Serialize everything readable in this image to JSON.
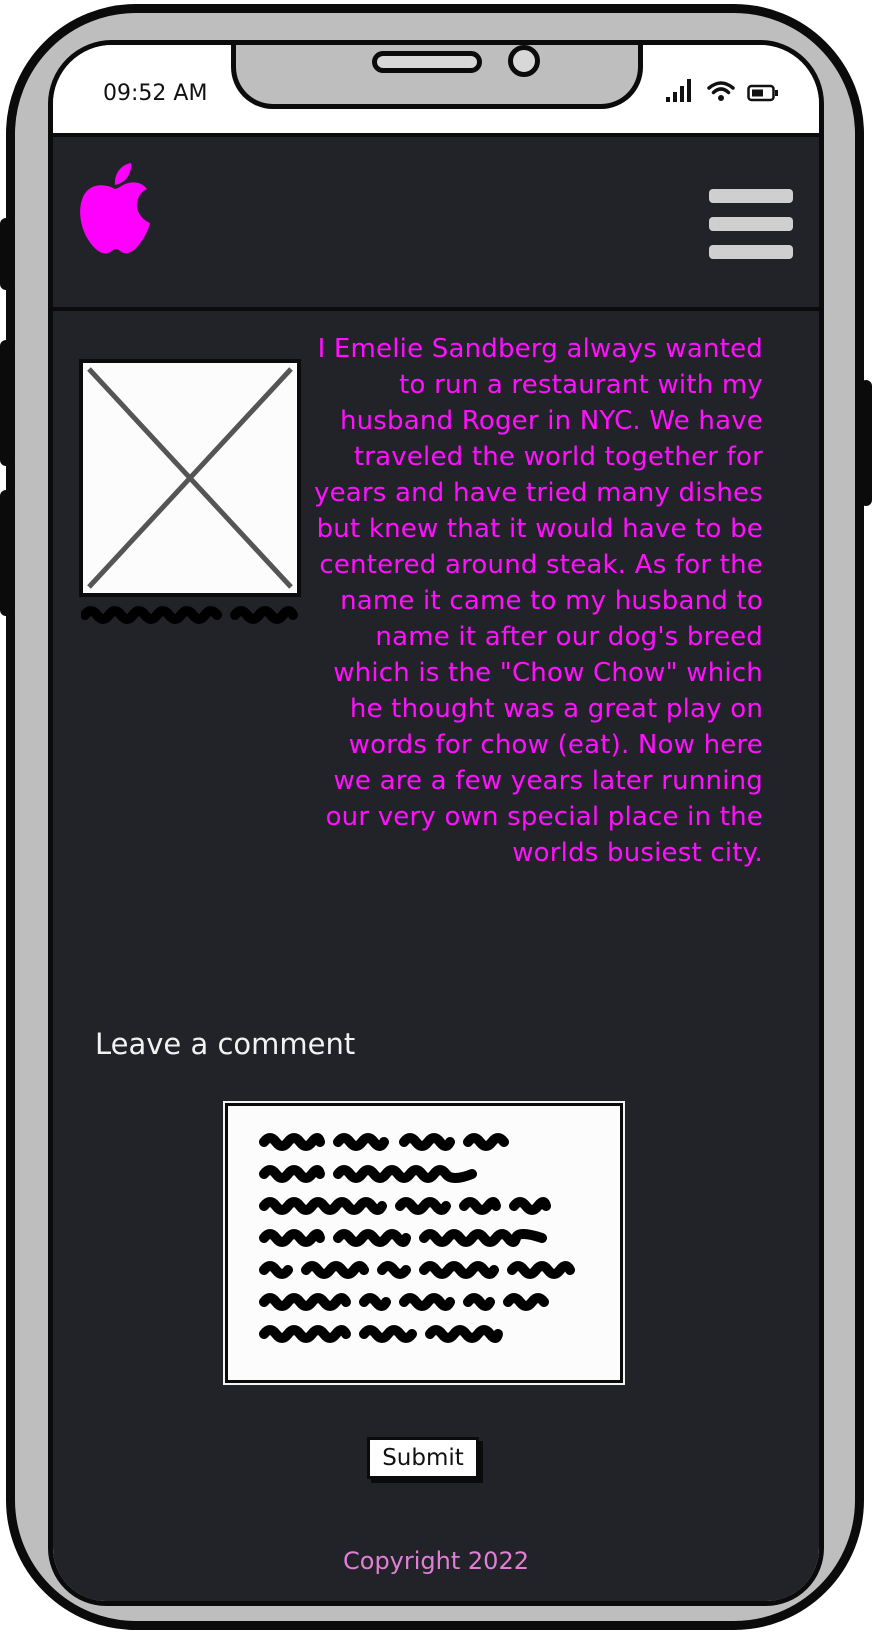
{
  "status_bar": {
    "time": "09:52 AM",
    "icons": [
      "signal-icon",
      "wifi-icon",
      "battery-icon"
    ]
  },
  "header": {
    "logo_icon": "apple-logo-icon",
    "menu_icon": "hamburger-menu-icon"
  },
  "about": {
    "image_icon": "image-placeholder-icon",
    "bio": "I Emelie Sandberg always wanted to run a restaurant with my husband Roger in NYC. We have traveled the world together for years and have tried many dishes but knew that it would have to be centered around steak. As for the name it came to my husband to name it after our dog's breed which is the \"Chow Chow\" which he thought was a great play on words for chow (eat). Now here we are a few years later running our very own special place in the worlds busiest city."
  },
  "comment": {
    "heading": "Leave a comment",
    "submit_label": "Submit"
  },
  "footer": {
    "copyright": "Copyright 2022"
  },
  "colors": {
    "accent": "#ff10ff",
    "background": "#222328",
    "footer_text": "#e07fd6"
  }
}
